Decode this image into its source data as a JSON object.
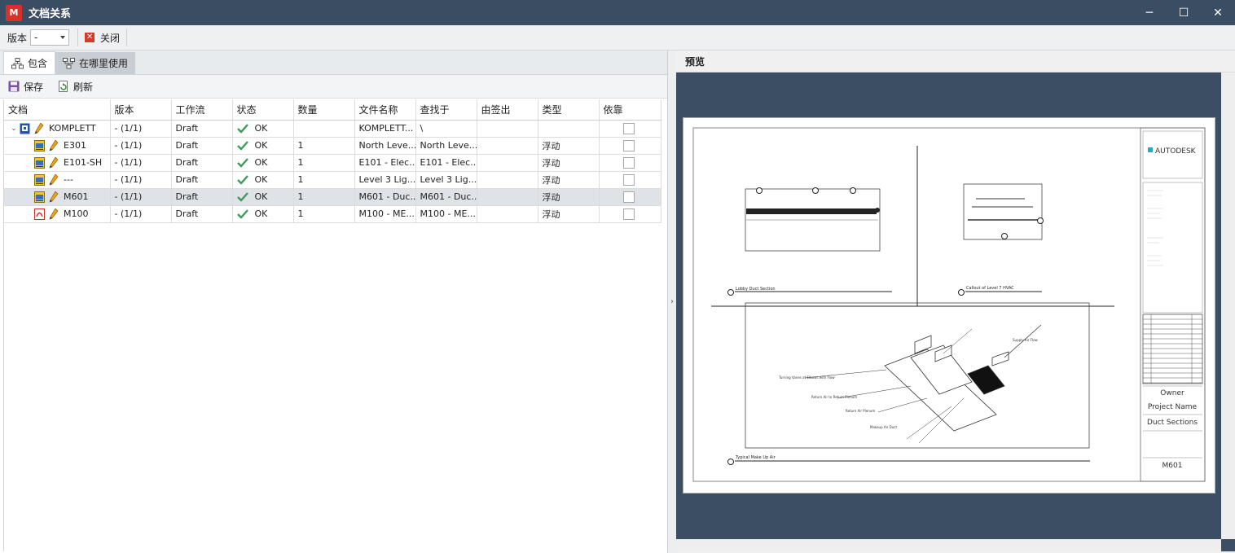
{
  "window": {
    "logo_text": "M",
    "title": "文档关系",
    "minimize": "─",
    "maximize": "☐",
    "close": "✕"
  },
  "toolbar": {
    "version_label": "版本",
    "version_value": "-",
    "close_label": "关闭"
  },
  "tabs": [
    {
      "label": "包含"
    },
    {
      "label": "在哪里使用"
    }
  ],
  "subtoolbar": {
    "save_label": "保存",
    "refresh_label": "刷新"
  },
  "table": {
    "columns": [
      "文档",
      "版本",
      "工作流",
      "状态",
      "数量",
      "文件名称",
      "查找于",
      "由签出",
      "类型",
      "依靠"
    ],
    "rows": [
      {
        "doc": "KOMPLETT",
        "version": "- (1/1)",
        "workflow": "Draft",
        "status": "OK",
        "qty": "",
        "filename": "KOMPLETT...",
        "found_in": "\\",
        "checked_out": "",
        "type": "",
        "icon": "assembly"
      },
      {
        "doc": "E301",
        "version": "- (1/1)",
        "workflow": "Draft",
        "status": "OK",
        "qty": "1",
        "filename": "North Leve...",
        "found_in": "North Leve...",
        "checked_out": "",
        "type": "浮动",
        "icon": "sheet"
      },
      {
        "doc": "E101-SH",
        "version": "- (1/1)",
        "workflow": "Draft",
        "status": "OK",
        "qty": "1",
        "filename": "E101 - Elec...",
        "found_in": "E101 - Elec...",
        "checked_out": "",
        "type": "浮动",
        "icon": "sheet"
      },
      {
        "doc": "---",
        "version": "- (1/1)",
        "workflow": "Draft",
        "status": "OK",
        "qty": "1",
        "filename": "Level 3 Lig...",
        "found_in": "Level 3 Lig...",
        "checked_out": "",
        "type": "浮动",
        "icon": "sheet"
      },
      {
        "doc": "M601",
        "version": "- (1/1)",
        "workflow": "Draft",
        "status": "OK",
        "qty": "1",
        "filename": "M601 - Duc...",
        "found_in": "M601 - Duc...",
        "checked_out": "",
        "type": "浮动",
        "icon": "sheet",
        "selected": true
      },
      {
        "doc": "M100",
        "version": "- (1/1)",
        "workflow": "Draft",
        "status": "OK",
        "qty": "1",
        "filename": "M100 - ME...",
        "found_in": "M100 - ME...",
        "checked_out": "",
        "type": "浮动",
        "icon": "pdf"
      }
    ]
  },
  "preview": {
    "heading": "预览",
    "sheet": {
      "brand": "AUTODESK",
      "view1_label": "Lobby Duct Section",
      "view2_label": "Callout of Level 7 HVAC",
      "view3_label": "Typical Make Up Air",
      "owner": "Owner",
      "project_name": "Project Name",
      "sheet_title": "Duct Sections",
      "sheet_number": "M601",
      "annotations": [
        "Turning Vanes at Elbows with Flow",
        "Return Air to Return Plenum",
        "Return Air Plenum",
        "Makeup Air Duct",
        "Supply Air Flow"
      ]
    }
  },
  "colors": {
    "titlebar": "#3a4d63",
    "preview_bg": "#3c4e63",
    "accent_red": "#d8312c",
    "ok_green": "#3f9a5a",
    "selected_row": "#dfe3e7"
  }
}
